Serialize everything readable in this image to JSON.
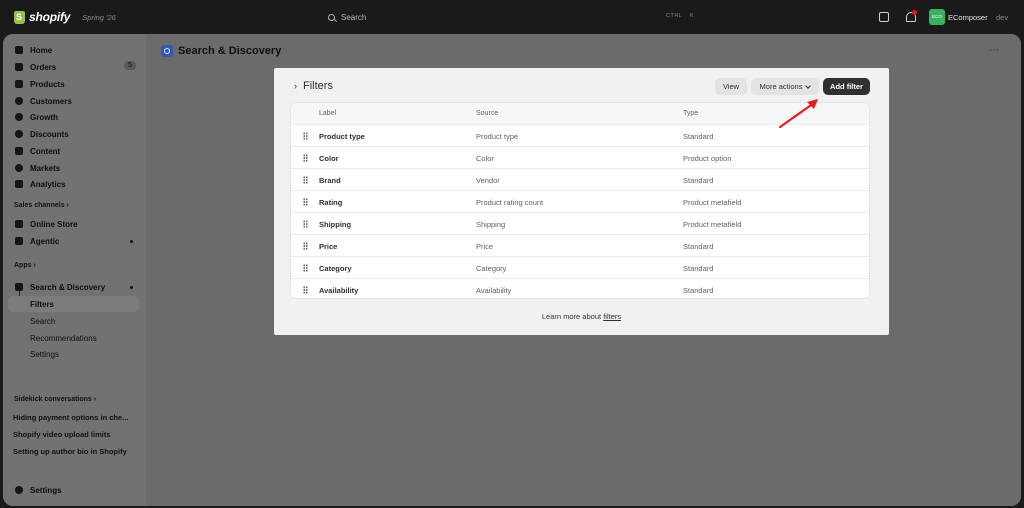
{
  "topbar": {
    "brand": "shopify",
    "edition": "Spring '26",
    "search_placeholder": "Search",
    "search_shortcut_1": "CTRL",
    "search_shortcut_2": "K",
    "store_initials": "ECO",
    "store_name": "EComposer",
    "store_suffix": "dev"
  },
  "sidebar": {
    "items": [
      {
        "label": "Home"
      },
      {
        "label": "Orders",
        "badge": "5"
      },
      {
        "label": "Products"
      },
      {
        "label": "Customers"
      },
      {
        "label": "Growth"
      },
      {
        "label": "Discounts"
      },
      {
        "label": "Content"
      },
      {
        "label": "Markets"
      },
      {
        "label": "Analytics"
      }
    ],
    "sales_channels_label": "Sales channels",
    "channels": [
      {
        "label": "Online Store"
      },
      {
        "label": "Agentic"
      }
    ],
    "apps_label": "Apps",
    "app": {
      "label": "Search & Discovery"
    },
    "app_subitems": [
      {
        "label": "Filters"
      },
      {
        "label": "Search"
      },
      {
        "label": "Recommendations"
      },
      {
        "label": "Settings"
      }
    ],
    "sidekick_label": "Sidekick conversations",
    "conversations": [
      {
        "label": "Hiding payment options in che..."
      },
      {
        "label": "Shopify video upload limits"
      },
      {
        "label": "Setting up author bio in Shopify"
      }
    ],
    "settings_label": "Settings"
  },
  "page": {
    "title": "Search & Discovery",
    "more_icon": "⋯"
  },
  "filters_card": {
    "title": "Filters",
    "view_button": "View",
    "more_actions_button": "More actions",
    "add_filter_button": "Add filter",
    "columns": [
      "Label",
      "Source",
      "Type"
    ],
    "rows": [
      {
        "label": "Product type",
        "source": "Product type",
        "type": "Standard"
      },
      {
        "label": "Color",
        "source": "Color",
        "type": "Product option"
      },
      {
        "label": "Brand",
        "source": "Vendor",
        "type": "Standard"
      },
      {
        "label": "Rating",
        "source": "Product rating count",
        "type": "Product metafield"
      },
      {
        "label": "Shipping",
        "source": "Shipping",
        "type": "Product metafield"
      },
      {
        "label": "Price",
        "source": "Price",
        "type": "Standard"
      },
      {
        "label": "Category",
        "source": "Category",
        "type": "Standard"
      },
      {
        "label": "Availability",
        "source": "Availability",
        "type": "Standard"
      }
    ],
    "learn_more_prefix": "Learn more about",
    "learn_more_link": "filters"
  },
  "colors": {
    "accent_button": "#303030",
    "annotation_arrow": "#e8191f",
    "store_badge": "#36b35c"
  }
}
